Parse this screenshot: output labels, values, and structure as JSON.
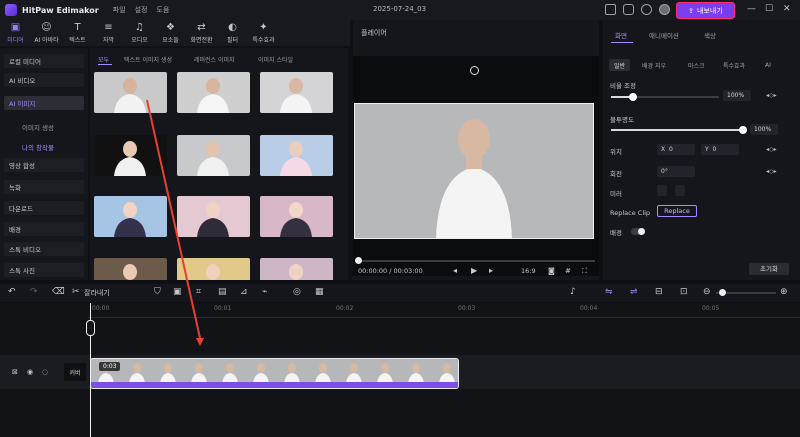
{
  "app": {
    "name": "HitPaw Edimakor",
    "menu": [
      "파일",
      "설정",
      "도움"
    ],
    "project_title": "2025-07-24_03",
    "export_label": "내보내기"
  },
  "toolbar": [
    {
      "label": "미디어",
      "icon": "media-icon",
      "active": true
    },
    {
      "label": "AI 아바타",
      "icon": "avatar-icon"
    },
    {
      "label": "텍스트",
      "icon": "text-icon"
    },
    {
      "label": "자막",
      "icon": "subtitle-icon"
    },
    {
      "label": "오디오",
      "icon": "audio-icon"
    },
    {
      "label": "요소들",
      "icon": "elements-icon"
    },
    {
      "label": "화면전환",
      "icon": "transition-icon"
    },
    {
      "label": "필터",
      "icon": "filter-icon"
    },
    {
      "label": "특수효과",
      "icon": "effects-icon"
    }
  ],
  "leftnav": {
    "items": [
      {
        "label": "로컬 미디어"
      },
      {
        "label": "AI 비디오"
      },
      {
        "label": "AI 이미지",
        "active": true
      },
      {
        "label": "영상 합성"
      },
      {
        "label": "녹화"
      },
      {
        "label": "다운로드"
      },
      {
        "label": "배경"
      },
      {
        "label": "스톡 비디오"
      },
      {
        "label": "스톡 사진"
      }
    ],
    "subs": [
      {
        "label": "이미지 생성"
      },
      {
        "label": "나의 창작물",
        "active": true
      }
    ]
  },
  "media_tabs": [
    "모두",
    "텍스트 이미지 생성",
    "레퍼런스 이미지",
    "이미지 스타일"
  ],
  "preview": {
    "label": "플레이어",
    "timecode": "00:00:00 / 00:03:00",
    "ratio": "16:9"
  },
  "props": {
    "tabs": [
      "화면",
      "애니메이션",
      "색상"
    ],
    "subtabs": [
      "일반",
      "배경 지우",
      "마스크",
      "특수효과",
      "AI"
    ],
    "scale_label": "비율 조정",
    "scale_value": "100%",
    "opacity_label": "불투명도",
    "opacity_value": "100%",
    "position_label": "위치",
    "x_label": "X",
    "x_value": "0",
    "y_label": "Y",
    "y_value": "0",
    "rotation_label": "회전",
    "rotation_value": "0°",
    "mirror_label": "미러",
    "replace_label": "Replace Clip",
    "replace_button": "Replace",
    "bg_label": "배경",
    "reset_label": "초기화"
  },
  "edit_toolbar": {
    "split_label": "잘라내기"
  },
  "timeline": {
    "ticks": [
      "00:00",
      "00:01",
      "00:02",
      "00:03",
      "00:04",
      "00:05"
    ],
    "track_label": "커버",
    "clip_time": "0:03"
  }
}
